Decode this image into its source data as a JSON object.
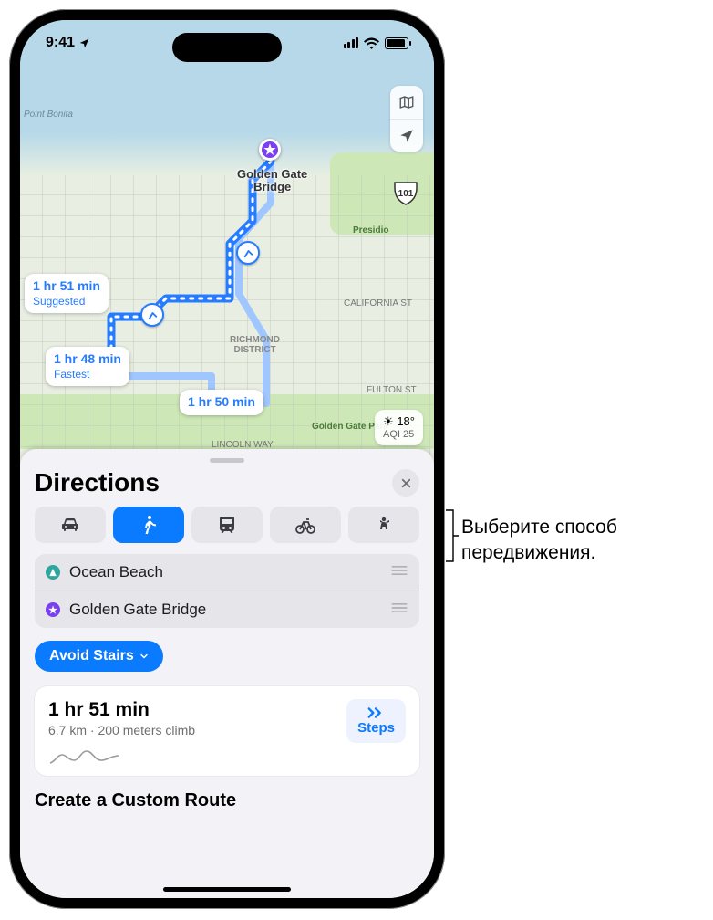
{
  "status_bar": {
    "time": "9:41"
  },
  "map": {
    "destination_label": "Golden Gate\nBridge",
    "poi_point": "Point Bonita",
    "district": "RICHMOND\nDISTRICT",
    "park_name": "Presidio",
    "park_name2": "Golden Gate Park",
    "street1": "CALIFORNIA ST",
    "street2": "FULTON ST",
    "street3": "LINCOLN WAY",
    "hwy_num": "101",
    "route_bubbles": {
      "suggested": {
        "time": "1 hr 51 min",
        "tag": "Suggested"
      },
      "fastest": {
        "time": "1 hr 48 min",
        "tag": "Fastest"
      },
      "alt": {
        "time": "1 hr 50 min"
      }
    },
    "weather": {
      "temp": "18°",
      "aqi": "AQI 25"
    }
  },
  "sheet": {
    "title": "Directions",
    "modes": [
      "drive",
      "walk",
      "transit",
      "cycle",
      "ride"
    ],
    "selected_mode": "walk",
    "stops": [
      {
        "label": "Ocean Beach",
        "kind": "start"
      },
      {
        "label": "Golden Gate Bridge",
        "kind": "end"
      }
    ],
    "option_label": "Avoid Stairs",
    "route": {
      "time": "1 hr 51 min",
      "subtitle": "6.7 km · 200 meters climb",
      "steps_label": "Steps"
    },
    "custom_label": "Create a Custom Route"
  },
  "callout": {
    "line1": "Выберите способ",
    "line2": "передвижения."
  }
}
